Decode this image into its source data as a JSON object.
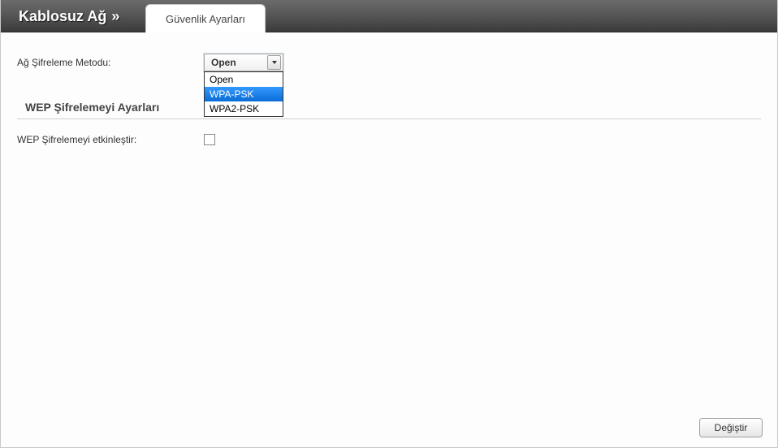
{
  "breadcrumb": {
    "section": "Kablosuz Ağ",
    "separator": "»"
  },
  "tabs": [
    {
      "label": "Güvenlik Ayarları",
      "active": true
    }
  ],
  "form": {
    "encryption_method_label": "Ağ Şifreleme Metodu:",
    "encryption_method_value": "Open",
    "encryption_options": [
      "Open",
      "WPA-PSK",
      "WPA2-PSK"
    ],
    "highlighted_option_index": 1,
    "wep_section_title": "WEP Şifrelemeyi Ayarları",
    "wep_enable_label": "WEP Şifrelemeyi etkinleştir:",
    "wep_enable_checked": false
  },
  "buttons": {
    "submit": "Değiştir"
  }
}
